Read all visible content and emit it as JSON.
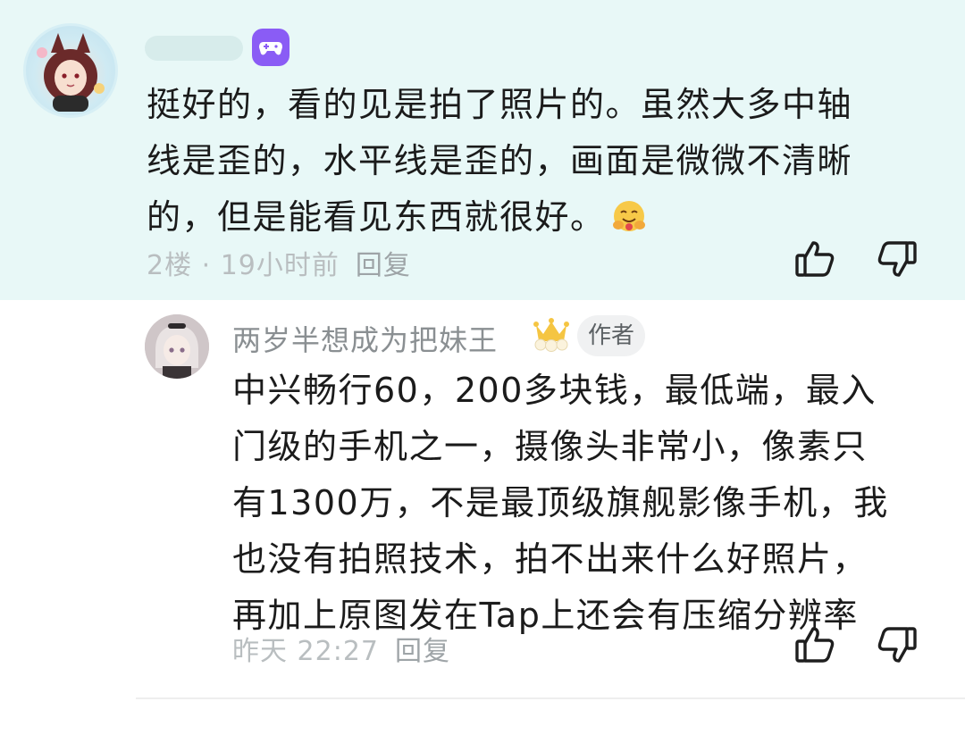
{
  "comment1": {
    "lines": [
      "挺好的，看的见是拍了照片的。虽然大多中轴",
      "线是歪的，水平线是歪的，画面是微微不清晰",
      "的，但是能看见东西就很好。"
    ],
    "emoji": "hugging-face-emoji",
    "floor_time": "2楼 · 19小时前",
    "reply_label": "回复",
    "badge_icon": "gamepad-icon"
  },
  "reply1": {
    "username": "两岁半想成为把妹王",
    "author_tag": "作者",
    "lines": [
      "中兴畅行60，200多块钱，最低端，最入",
      "门级的手机之一，摄像头非常小，像素只",
      "有1300万，不是最顶级旗舰影像手机，我",
      "也没有拍照技术，拍不出来什么好照片，",
      "再加上原图发在Tap上还会有压缩分辨率"
    ],
    "time": "昨天 22:27",
    "reply_label": "回复"
  },
  "colors": {
    "highlight_bg": "#e8f8f7",
    "badge_purple": "#8a5cf5",
    "meta_gray": "#b9bec0"
  }
}
